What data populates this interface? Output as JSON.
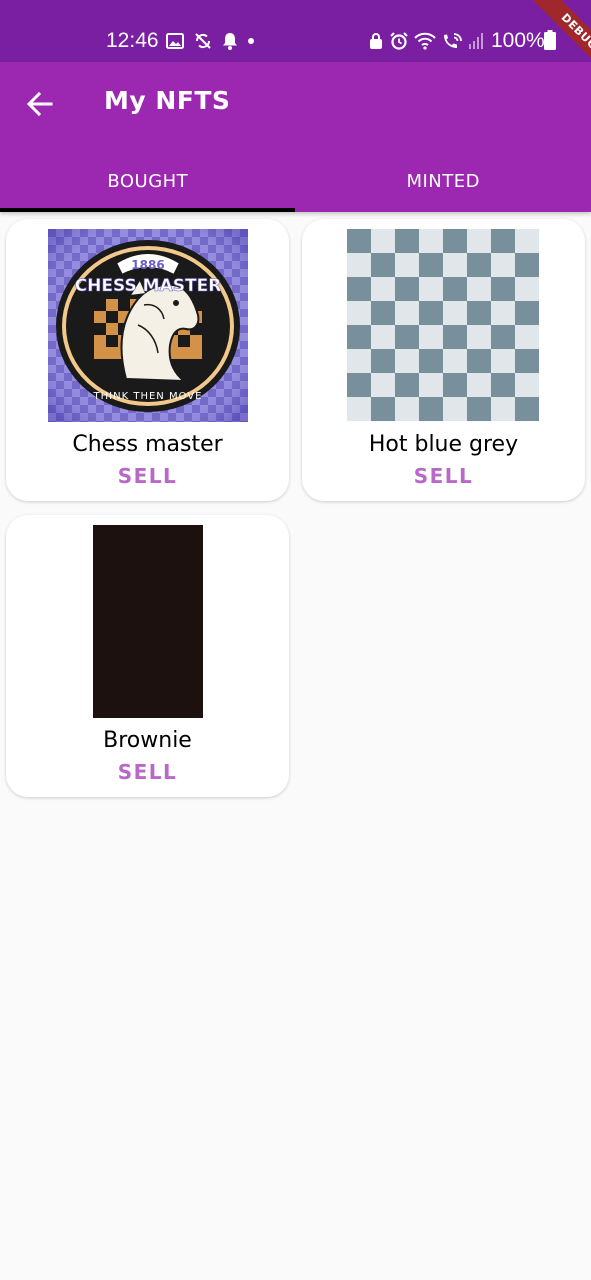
{
  "status_bar": {
    "time": "12:46",
    "battery_percent": "100%",
    "left_icons": [
      "image-icon",
      "sync-off-icon",
      "bell-icon",
      "dot-icon"
    ],
    "right_icons": [
      "lock-icon",
      "alarm-icon",
      "wifi-icon",
      "wifi-call-icon",
      "signal-icon"
    ]
  },
  "debug_banner": "DEBUG",
  "app_bar": {
    "title": "My NFTS",
    "back_icon": "arrow-back-icon"
  },
  "tabs": [
    {
      "label": "BOUGHT",
      "selected": true
    },
    {
      "label": "MINTED",
      "selected": false
    }
  ],
  "nfts": [
    {
      "name": "Chess master",
      "action": "SELL",
      "badge_top": "1886",
      "badge_main": "CHESS MASTER",
      "badge_bottom": "THINK THEN MOVE"
    },
    {
      "name": "Hot blue grey",
      "action": "SELL"
    },
    {
      "name": "Brownie",
      "action": "SELL"
    }
  ],
  "colors": {
    "status_bar": "#7b1fa2",
    "app_bar": "#9c27b0",
    "tab_indicator": "#000000",
    "sell_text": "#ba68c8",
    "background": "#fafafa",
    "checker_dark": "#78909c",
    "checker_light": "#e0e6ea",
    "brownie": "#1c110f"
  }
}
